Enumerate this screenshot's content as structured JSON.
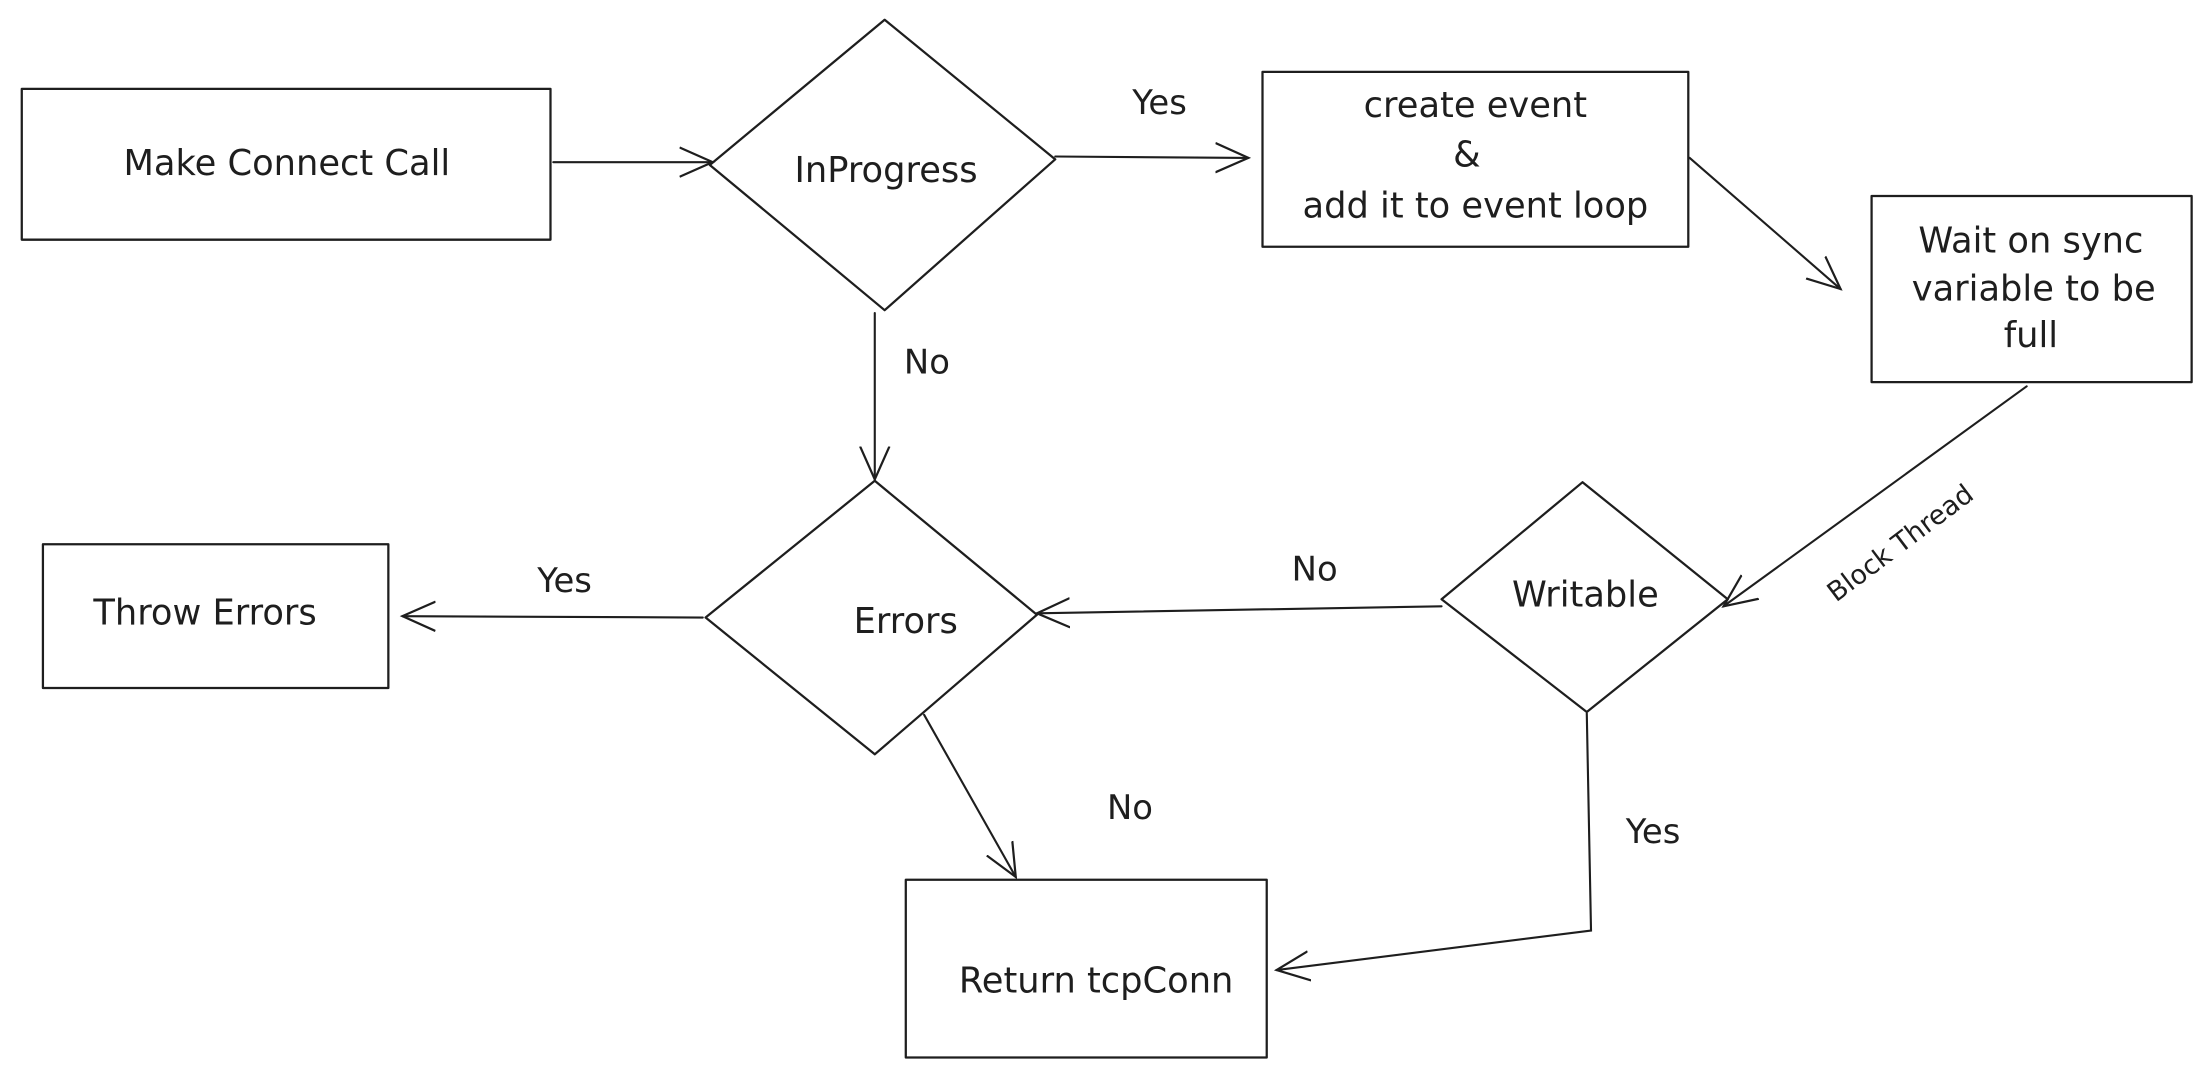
{
  "nodes": {
    "make_connect": "Make Connect Call",
    "in_progress": "InProgress",
    "create_event": [
      "create event",
      "&",
      "add it to event loop"
    ],
    "wait_sync": [
      "Wait on sync",
      "variable to be",
      "full"
    ],
    "writable": "Writable",
    "errors": "Errors",
    "throw_errors": "Throw Errors",
    "return_conn": "Return tcpConn"
  },
  "edges": {
    "inprogress_yes": "Yes",
    "inprogress_no": "No",
    "block_thread": "Block Thread",
    "writable_no": "No",
    "writable_yes": "Yes",
    "errors_yes": "Yes",
    "errors_no": "No"
  },
  "colors": {
    "stroke": "#1e1e1e",
    "background": "#ffffff"
  }
}
